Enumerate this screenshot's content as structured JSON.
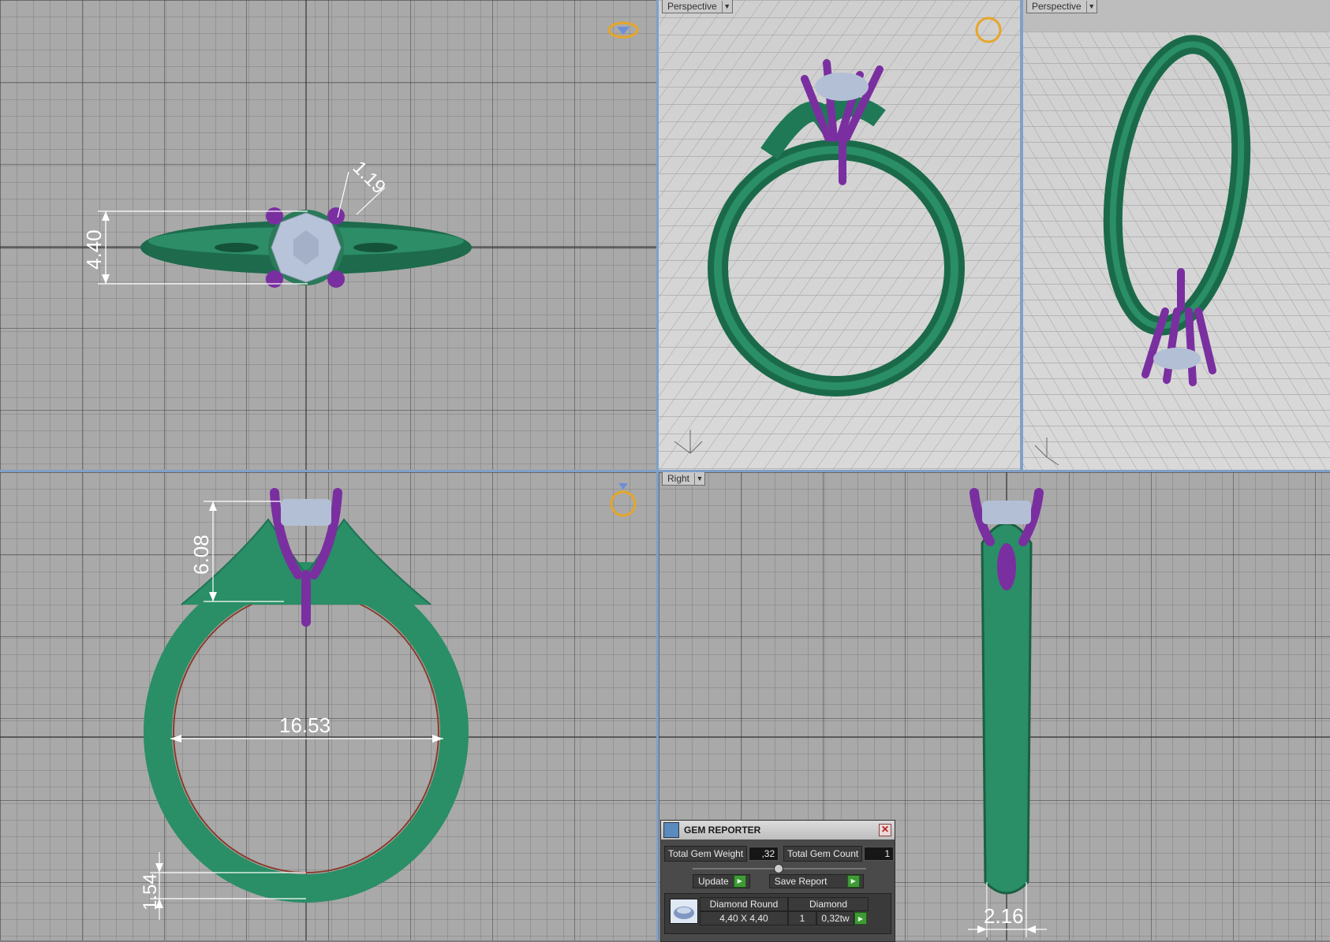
{
  "viewports": {
    "top_left": {
      "label": "",
      "dims": {
        "gem_width": "4.40",
        "prong": "1.19"
      }
    },
    "top_mid": {
      "label": "Perspective"
    },
    "top_right": {
      "label": "Perspective"
    },
    "bottom_left": {
      "label": "",
      "dims": {
        "height": "6.08",
        "inner_diameter": "16.53",
        "band_thickness": "1.54"
      }
    },
    "bottom_right": {
      "label": "Right",
      "dims": {
        "band_width": "2.16"
      }
    }
  },
  "gem_reporter": {
    "title": "GEM REPORTER",
    "total_weight_label": "Total Gem Weight",
    "total_weight_value": ",32",
    "total_count_label": "Total Gem Count",
    "total_count_value": "1",
    "update_label": "Update",
    "save_label": "Save Report",
    "row": {
      "shape": "Diamond Round",
      "material": "Diamond",
      "size": "4,40 X 4,40",
      "count": "1",
      "weight": "0,32tw"
    }
  },
  "colors": {
    "band": "#22805e",
    "prongs": "#7a2fa0",
    "gem": "#b8c4d8",
    "background": "#a9a9a9"
  },
  "icons": [
    "diamond-ring-orientation-icon",
    "gold-ring-icon",
    "dropdown-arrow-icon",
    "close-icon",
    "play-arrow-icon"
  ]
}
